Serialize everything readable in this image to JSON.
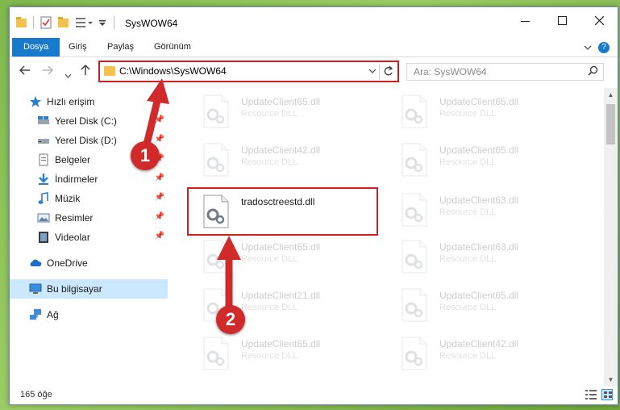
{
  "window": {
    "title": "SysWOW64"
  },
  "ribbon": {
    "tabs": [
      {
        "label": "Dosya"
      },
      {
        "label": "Giriş"
      },
      {
        "label": "Paylaş"
      },
      {
        "label": "Görünüm"
      }
    ]
  },
  "address_bar": {
    "path": "C:\\Windows\\SysWOW64"
  },
  "search": {
    "placeholder": "Ara: SysWOW64"
  },
  "sidebar": {
    "items": [
      {
        "label": "Hızlı erişim",
        "icon": "star-icon",
        "pinned": false
      },
      {
        "label": "Yerel Disk (C:)",
        "icon": "drive-icon",
        "pinned": true
      },
      {
        "label": "Yerel Disk (D:)",
        "icon": "drive-icon",
        "pinned": true
      },
      {
        "label": "Belgeler",
        "icon": "documents-icon",
        "pinned": true
      },
      {
        "label": "İndirmeler",
        "icon": "download-icon",
        "pinned": true
      },
      {
        "label": "Müzik",
        "icon": "music-icon",
        "pinned": true
      },
      {
        "label": "Resimler",
        "icon": "pictures-icon",
        "pinned": true
      },
      {
        "label": "Videolar",
        "icon": "video-icon",
        "pinned": true
      },
      {
        "label": "OneDrive",
        "icon": "cloud-icon",
        "pinned": false
      },
      {
        "label": "Bu bilgisayar",
        "icon": "computer-icon",
        "pinned": false
      },
      {
        "label": "Ağ",
        "icon": "network-icon",
        "pinned": false
      }
    ]
  },
  "files": {
    "left": [
      {
        "name": "UpdateClient65.dll",
        "type": "Resource DLL"
      },
      {
        "name": "UpdateClient42.dll",
        "type": "Resource DLL"
      },
      {
        "name": "tradosctreestd.dll",
        "type": ""
      },
      {
        "name": "UpdateClient65.dll",
        "type": "Resource DLL"
      },
      {
        "name": "UpdateClient21.dll",
        "type": "Resource DLL"
      },
      {
        "name": "UpdateClient65.dll",
        "type": "Resource DLL"
      }
    ],
    "right": [
      {
        "name": "UpdateClient65.dll",
        "type": "Resource DLL"
      },
      {
        "name": "UpdateClient65.dll",
        "type": "Resource DLL"
      },
      {
        "name": "UpdateClient63.dll",
        "type": "Resource DLL"
      },
      {
        "name": "UpdateClient63.dll",
        "type": "Resource DLL"
      },
      {
        "name": "UpdateClient65.dll",
        "type": "Resource DLL"
      },
      {
        "name": "UpdateClient42.dll",
        "type": "Resource DLL"
      }
    ]
  },
  "status": {
    "count": "165 öğe"
  },
  "annotations": {
    "step1": "1",
    "step2": "2",
    "color": "#d12a2a"
  },
  "colors": {
    "accent": "#1979ca",
    "highlight": "#d11f1f",
    "selected": "#cce8ff"
  }
}
